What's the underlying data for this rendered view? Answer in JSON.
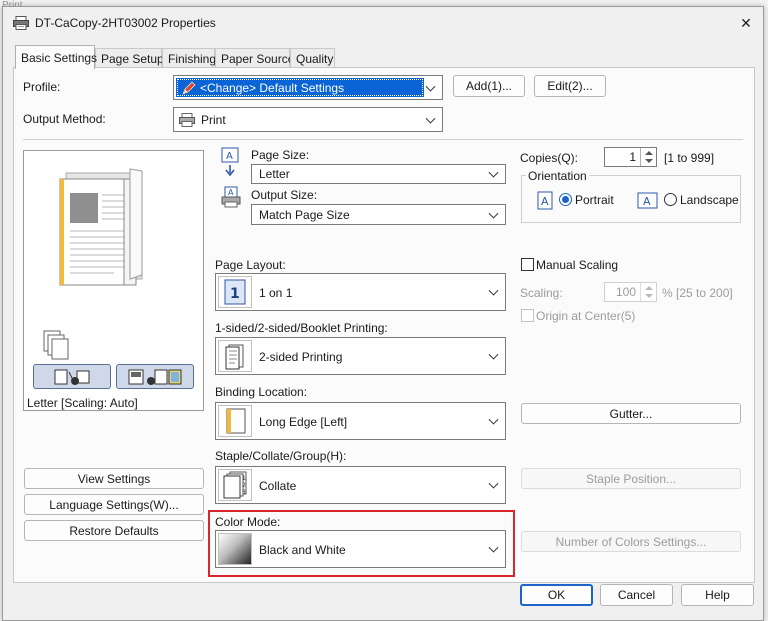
{
  "background": {
    "partial_text": "Print"
  },
  "window": {
    "title": "DT-CaCopy-2HT03002 Properties",
    "close_glyph": "✕"
  },
  "tabs": [
    {
      "label": "Basic Settings"
    },
    {
      "label": "Page Setup"
    },
    {
      "label": "Finishing"
    },
    {
      "label": "Paper Source"
    },
    {
      "label": "Quality"
    }
  ],
  "profile": {
    "label": "Profile:",
    "value": "<Change> Default Settings",
    "add_button": "Add(1)...",
    "edit_button": "Edit(2)..."
  },
  "output_method": {
    "label": "Output Method:",
    "value": "Print"
  },
  "preview": {
    "caption": "Letter [Scaling: Auto]"
  },
  "left_buttons": {
    "view_settings": "View Settings",
    "language_settings": "Language Settings(W)...",
    "restore_defaults": "Restore Defaults"
  },
  "page_size": {
    "label": "Page Size:",
    "value": "Letter"
  },
  "output_size": {
    "label": "Output Size:",
    "value": "Match Page Size"
  },
  "copies": {
    "label": "Copies(Q):",
    "value": "1",
    "range": "[1 to 999]"
  },
  "orientation": {
    "label": "Orientation",
    "portrait": "Portrait",
    "landscape": "Landscape",
    "selected": "Portrait"
  },
  "page_layout": {
    "label": "Page Layout:",
    "value": "1 on 1",
    "icon_text": "1"
  },
  "manual_scaling": {
    "label": "Manual Scaling",
    "scaling_label": "Scaling:",
    "scaling_value": "100",
    "scaling_range": "% [25 to 200]",
    "origin_label": "Origin at Center(5)"
  },
  "sided_printing": {
    "label": "1-sided/2-sided/Booklet Printing:",
    "value": "2-sided Printing"
  },
  "binding": {
    "label": "Binding Location:",
    "value": "Long Edge [Left]",
    "gutter_button": "Gutter..."
  },
  "staple": {
    "label": "Staple/Collate/Group(H):",
    "value": "Collate",
    "position_button": "Staple Position..."
  },
  "color_mode": {
    "label": "Color Mode:",
    "value": "Black and White",
    "colors_button": "Number of Colors Settings..."
  },
  "footer": {
    "ok": "OK",
    "cancel": "Cancel",
    "help": "Help"
  },
  "colors": {
    "accent": "#1d63c9",
    "selection": "#0a64d6",
    "highlight": "#d9262e"
  }
}
